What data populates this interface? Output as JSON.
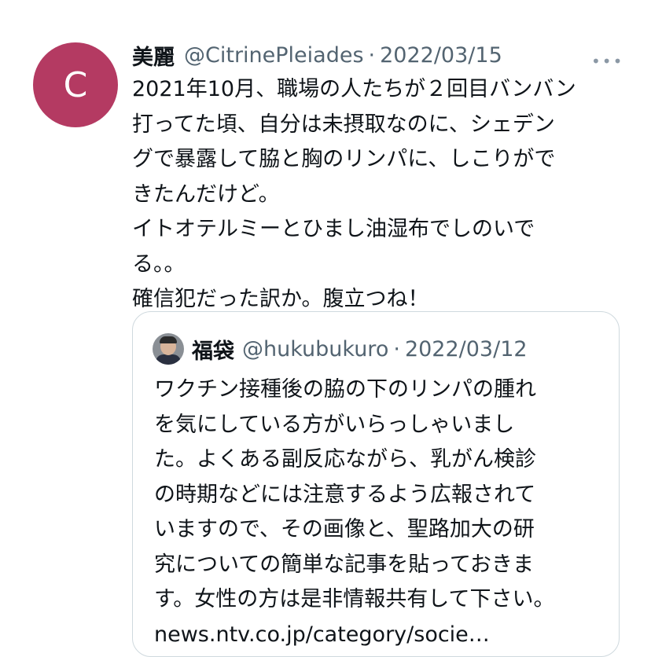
{
  "tweet": {
    "avatar_letter": "C",
    "avatar_color": "#b43a62",
    "display_name": "美麗",
    "handle": "@CitrinePleiades",
    "separator": "·",
    "date": "2022/03/15",
    "more_icon": "more-horizontal-icon",
    "lines": [
      "2021年10月、職場の人たちが２回目バンバン",
      "打ってた頃、自分は未摂取なのに、シェデン",
      "グで暴露して脇と胸のリンパに、しこりがで",
      "きたんだけど。",
      "イトオテルミーとひまし油湿布でしのいで",
      "る。。",
      "確信犯だった訳か。腹立つね！"
    ]
  },
  "quoted": {
    "display_name": "福袋",
    "handle": "@hukubukuro",
    "separator": "·",
    "date": "2022/03/12",
    "lines": [
      "ワクチン接種後の脇の下のリンパの腫れ",
      "を気にしている方がいらっしゃいまし",
      "た。よくある副反応ながら、乳がん検診",
      "の時期などには注意するよう広報されて",
      "いますので、その画像と、聖路加大の研",
      "究についての簡単な記事を貼っておきま",
      "す。女性の方は是非情報共有して下さい。",
      "news.ntv.co.jp/category/socie…"
    ]
  }
}
